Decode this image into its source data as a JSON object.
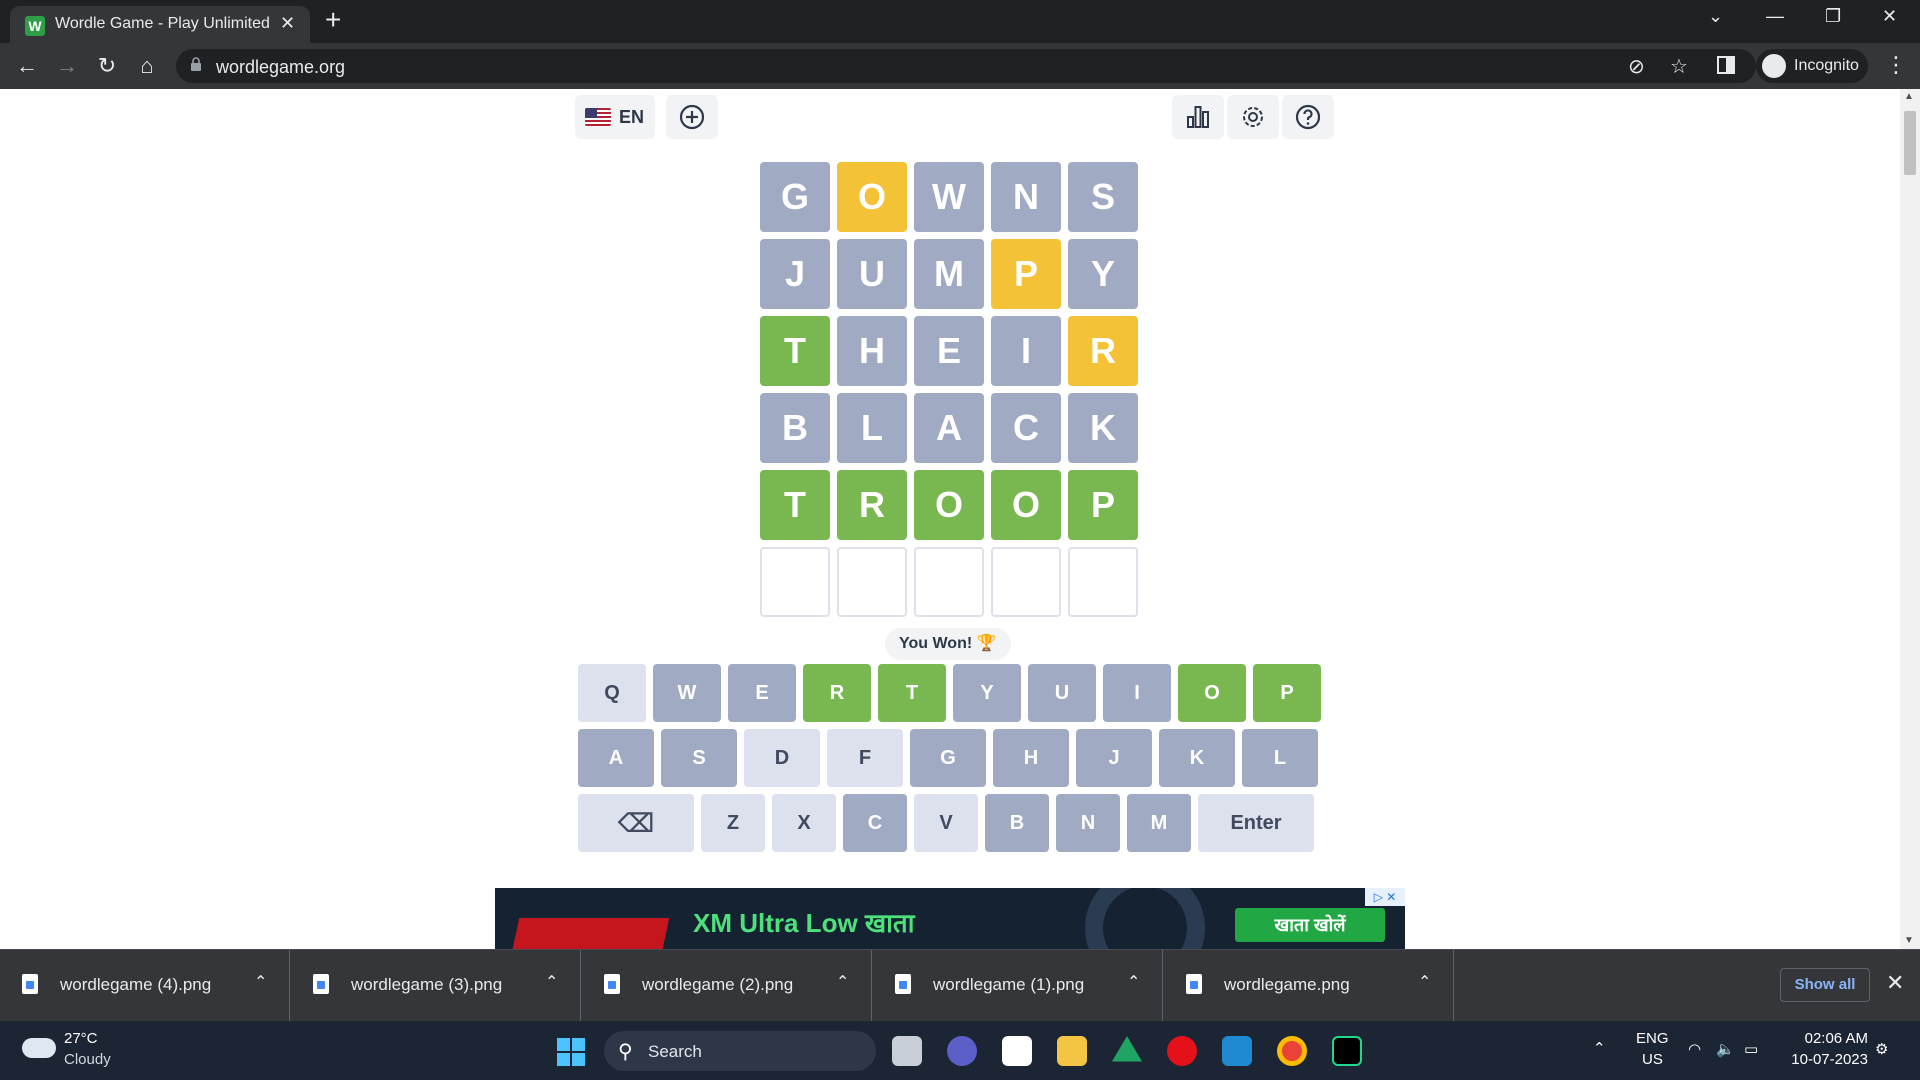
{
  "browser": {
    "tab_title": "Wordle Game - Play Unlimited",
    "tab_favicon": "W",
    "url": "wordlegame.org",
    "profile_label": "Incognito"
  },
  "toolbar": {
    "lang_label": "EN"
  },
  "board": {
    "rows": [
      [
        {
          "l": "G",
          "s": "absent"
        },
        {
          "l": "O",
          "s": "present"
        },
        {
          "l": "W",
          "s": "absent"
        },
        {
          "l": "N",
          "s": "absent"
        },
        {
          "l": "S",
          "s": "absent"
        }
      ],
      [
        {
          "l": "J",
          "s": "absent"
        },
        {
          "l": "U",
          "s": "absent"
        },
        {
          "l": "M",
          "s": "absent"
        },
        {
          "l": "P",
          "s": "present"
        },
        {
          "l": "Y",
          "s": "absent"
        }
      ],
      [
        {
          "l": "T",
          "s": "correct"
        },
        {
          "l": "H",
          "s": "absent"
        },
        {
          "l": "E",
          "s": "absent"
        },
        {
          "l": "I",
          "s": "absent"
        },
        {
          "l": "R",
          "s": "present"
        }
      ],
      [
        {
          "l": "B",
          "s": "absent"
        },
        {
          "l": "L",
          "s": "absent"
        },
        {
          "l": "A",
          "s": "absent"
        },
        {
          "l": "C",
          "s": "absent"
        },
        {
          "l": "K",
          "s": "absent"
        }
      ],
      [
        {
          "l": "T",
          "s": "correct"
        },
        {
          "l": "R",
          "s": "correct"
        },
        {
          "l": "O",
          "s": "correct"
        },
        {
          "l": "O",
          "s": "correct"
        },
        {
          "l": "P",
          "s": "correct"
        }
      ],
      [
        {
          "l": "",
          "s": "empty"
        },
        {
          "l": "",
          "s": "empty"
        },
        {
          "l": "",
          "s": "empty"
        },
        {
          "l": "",
          "s": "empty"
        },
        {
          "l": "",
          "s": "empty"
        }
      ]
    ]
  },
  "status_message": "You Won! 🏆",
  "keyboard": {
    "rows": [
      [
        {
          "k": "Q",
          "s": "unused"
        },
        {
          "k": "W",
          "s": "absent"
        },
        {
          "k": "E",
          "s": "absent"
        },
        {
          "k": "R",
          "s": "correct"
        },
        {
          "k": "T",
          "s": "correct"
        },
        {
          "k": "Y",
          "s": "absent"
        },
        {
          "k": "U",
          "s": "absent"
        },
        {
          "k": "I",
          "s": "absent"
        },
        {
          "k": "O",
          "s": "correct"
        },
        {
          "k": "P",
          "s": "correct"
        }
      ],
      [
        {
          "k": "A",
          "s": "absent"
        },
        {
          "k": "S",
          "s": "absent"
        },
        {
          "k": "D",
          "s": "unused"
        },
        {
          "k": "F",
          "s": "unused"
        },
        {
          "k": "G",
          "s": "absent"
        },
        {
          "k": "H",
          "s": "absent"
        },
        {
          "k": "J",
          "s": "absent"
        },
        {
          "k": "K",
          "s": "absent"
        },
        {
          "k": "L",
          "s": "absent"
        }
      ],
      [
        {
          "k": "⌫",
          "s": "unused",
          "wide": true
        },
        {
          "k": "Z",
          "s": "unused"
        },
        {
          "k": "X",
          "s": "unused"
        },
        {
          "k": "C",
          "s": "absent"
        },
        {
          "k": "V",
          "s": "unused"
        },
        {
          "k": "B",
          "s": "absent"
        },
        {
          "k": "N",
          "s": "absent"
        },
        {
          "k": "M",
          "s": "absent"
        },
        {
          "k": "Enter",
          "s": "unused",
          "wide": true
        }
      ]
    ]
  },
  "ad": {
    "headline": "XM Ultra Low खाता",
    "cta": "खाता खोलें"
  },
  "downloads": {
    "items": [
      "wordlegame (4).png",
      "wordlegame (3).png",
      "wordlegame (2).png",
      "wordlegame (1).png",
      "wordlegame.png"
    ],
    "show_all": "Show all"
  },
  "taskbar": {
    "weather_temp": "27°C",
    "weather_desc": "Cloudy",
    "search_label": "Search",
    "lang_top": "ENG",
    "lang_bottom": "US",
    "time": "02:06 AM",
    "date": "10-07-2023"
  },
  "colors": {
    "absent": "#a1aac3",
    "present": "#f3c237",
    "correct": "#79b851"
  }
}
